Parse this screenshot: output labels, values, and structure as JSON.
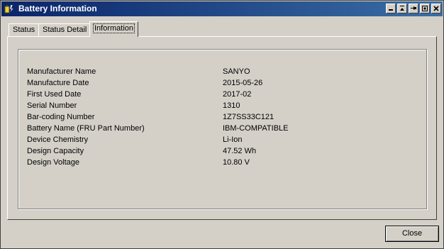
{
  "window": {
    "title": "Battery Information"
  },
  "tabs": [
    {
      "label": "Status"
    },
    {
      "label": "Status Detail"
    },
    {
      "label": "Information"
    }
  ],
  "info": {
    "rows": [
      {
        "label": "Manufacturer Name",
        "value": "SANYO"
      },
      {
        "label": "Manufacture Date",
        "value": "2015-05-26"
      },
      {
        "label": "First Used Date",
        "value": "2017-02"
      },
      {
        "label": "Serial Number",
        "value": "1310"
      },
      {
        "label": "Bar-coding Number",
        "value": "1Z7SS33C121"
      },
      {
        "label": "Battery Name (FRU Part Number)",
        "value": "IBM-COMPATIBLE"
      },
      {
        "label": "Device Chemistry",
        "value": "Li-Ion"
      },
      {
        "label": "Design Capacity",
        "value": "47.52 Wh"
      },
      {
        "label": "Design Voltage",
        "value": "10.80 V"
      }
    ]
  },
  "buttons": {
    "close_label": "Close"
  },
  "icons": {
    "app": "battery-app-icon",
    "title_buttons": [
      "help-icon",
      "minimize-icon",
      "pin-icon",
      "restore-icon",
      "close-icon"
    ]
  },
  "colors": {
    "titlebar_start": "#0a246a",
    "titlebar_end": "#3a6ea5",
    "face": "#d4d0c8"
  }
}
